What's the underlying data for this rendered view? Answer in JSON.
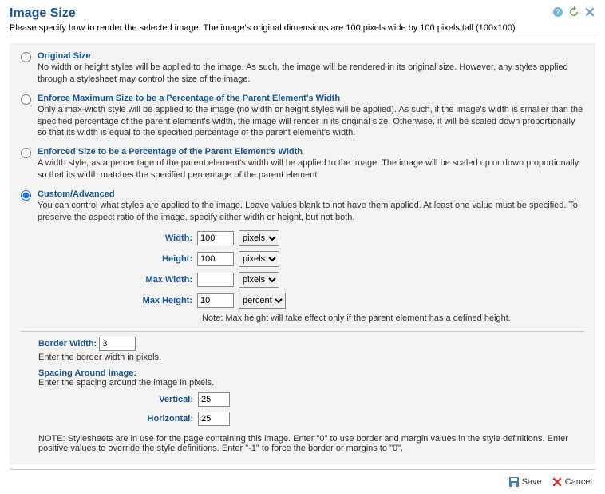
{
  "title": "Image Size",
  "intro": "Please specify how to render the selected image. The image's original dimensions are 100 pixels wide by 100 pixels tall (100x100).",
  "options": {
    "original": {
      "title": "Original Size",
      "desc": "No width or height styles will be applied to the image. As such, the image will be rendered in its original size. However, any styles applied through a stylesheet may control the size of the image."
    },
    "enforce_max": {
      "title": "Enforce Maximum Size to be a Percentage of the Parent Element's Width",
      "desc": "Only a max-width style will be applied to the image (no width or height styles will be applied). As such, if the image's width is smaller than the specified percentage of the parent element's width, the image will render in its original size. Otherwise, it will be scaled down proportionally so that its width is equal to the specified percentage of the parent element's width."
    },
    "enforced_pct": {
      "title": "Enforced Size to be a Percentage of the Parent Element's Width",
      "desc": "A width style, as a percentage of the parent element's width will be applied to the image. The image will be scaled up or down proportionally so that its width matches the specified percentage of the parent element."
    },
    "custom": {
      "title": "Custom/Advanced",
      "desc": "You can control what styles are applied to the image. Leave values blank to not have them applied. At least one value must be specified. To preserve the aspect ratio of the image, specify either width or height, but not both."
    }
  },
  "sizeFields": {
    "width": {
      "label": "Width:",
      "value": "100",
      "unit": "pixels"
    },
    "height": {
      "label": "Height:",
      "value": "100",
      "unit": "pixels"
    },
    "maxWidth": {
      "label": "Max Width:",
      "value": "",
      "unit": "pixels"
    },
    "maxHeight": {
      "label": "Max Height:",
      "value": "10",
      "unit": "percent"
    }
  },
  "maxHeightNote": "Note: Max height will take effect only if the parent element has a defined height.",
  "border": {
    "label": "Border Width:",
    "value": "3",
    "help": "Enter the border width in pixels."
  },
  "spacing": {
    "heading": "Spacing Around Image:",
    "help": "Enter the spacing around the image in pixels.",
    "vertical": {
      "label": "Vertical:",
      "value": "25"
    },
    "horizontal": {
      "label": "Horizontal:",
      "value": "25"
    }
  },
  "stylesheetNote": "NOTE: Stylesheets are in use for the page containing this image. Enter \"0\" to use border and margin values in the style definitions. Enter positive values to override the style definitions. Enter \"-1\" to force the border or margins to \"0\".",
  "unitOptions": [
    "pixels",
    "percent"
  ],
  "buttons": {
    "save": "Save",
    "cancel": "Cancel"
  }
}
